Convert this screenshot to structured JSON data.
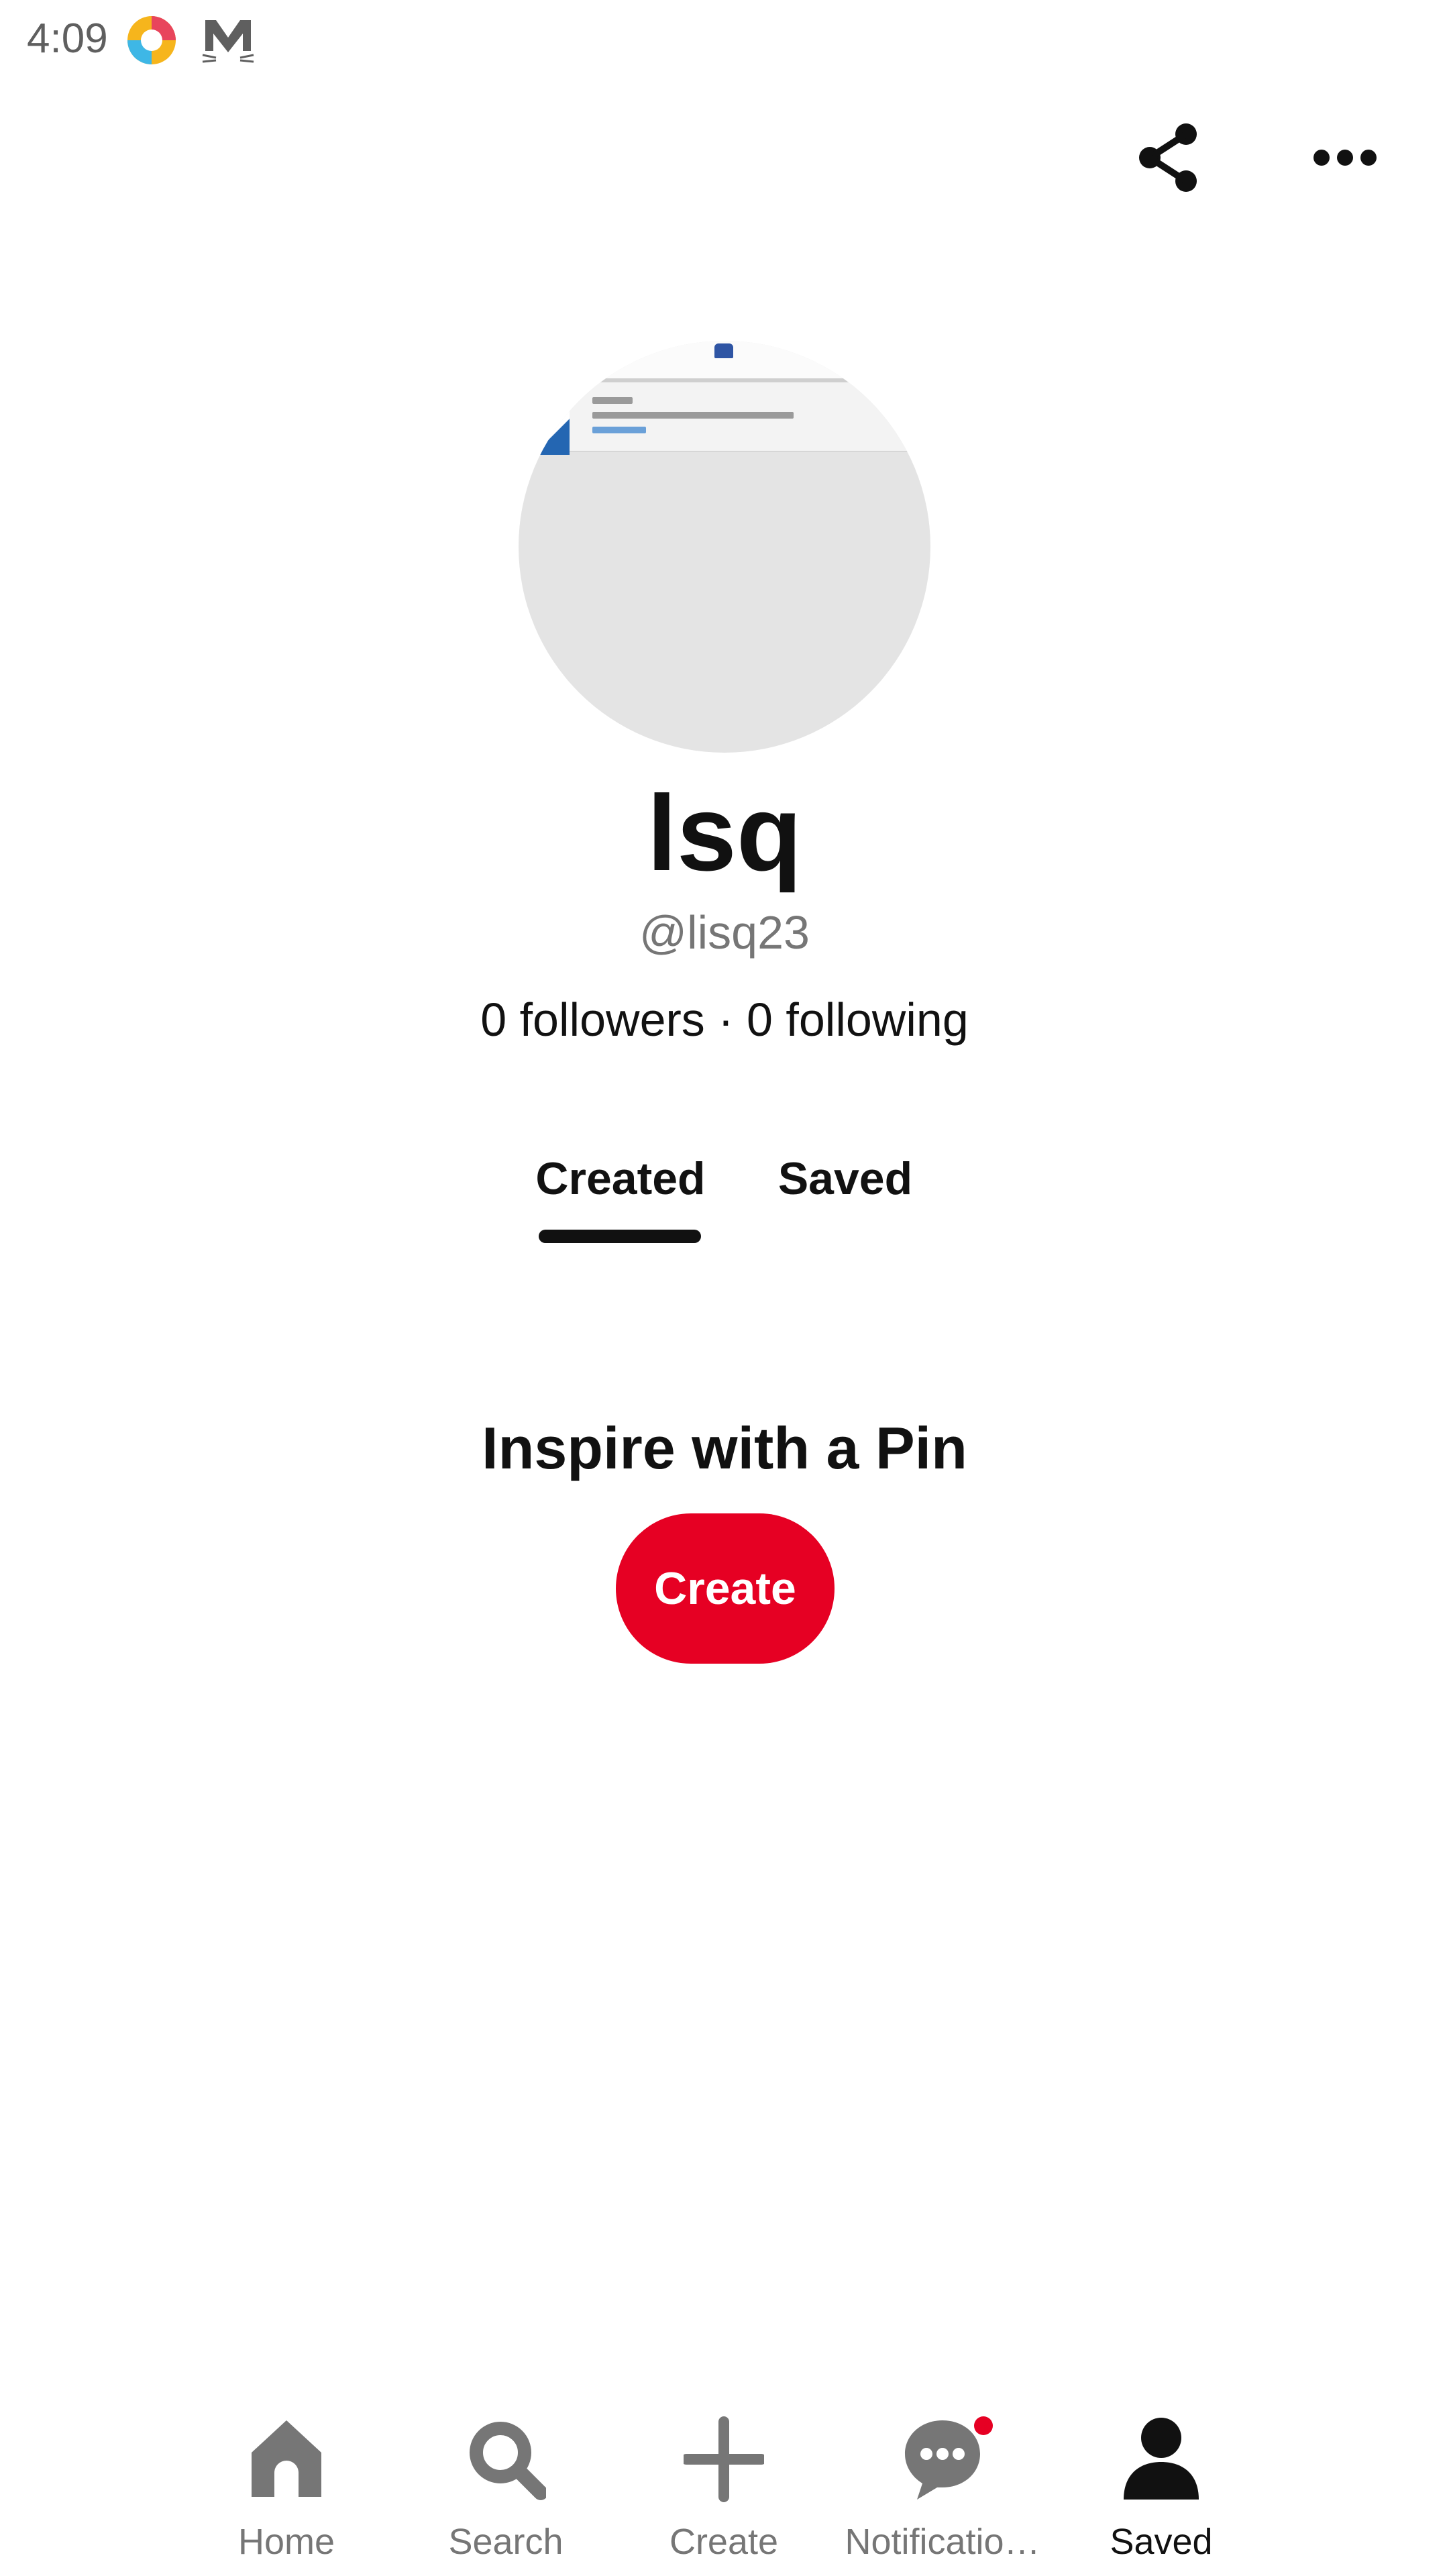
{
  "status_bar": {
    "time": "4:09",
    "icons": [
      "colorful-app-icon",
      "cat-mail-icon"
    ]
  },
  "top_actions": {
    "icons": [
      "share-icon",
      "more-options-icon"
    ]
  },
  "profile": {
    "display_name": "lsq",
    "handle": "@lisq23",
    "stats": "0 followers · 0 following"
  },
  "tabs": [
    {
      "label": "Created",
      "active": true
    },
    {
      "label": "Saved",
      "active": false
    }
  ],
  "empty_state": {
    "title": "Inspire with a Pin",
    "button_label": "Create"
  },
  "bottom_nav": {
    "items": [
      {
        "label": "Home",
        "icon": "home-icon",
        "active": false
      },
      {
        "label": "Search",
        "icon": "search-icon",
        "active": false
      },
      {
        "label": "Create",
        "icon": "plus-icon",
        "active": false
      },
      {
        "label": "Notificatio…",
        "icon": "chat-bubble-icon",
        "active": false,
        "has_badge": true
      },
      {
        "label": "Saved",
        "icon": "person-icon",
        "active": true
      }
    ]
  },
  "colors": {
    "brand_red": "#e60023",
    "text_primary": "#111111",
    "text_secondary": "#767676",
    "avatar_bg": "#e4e4e4"
  }
}
